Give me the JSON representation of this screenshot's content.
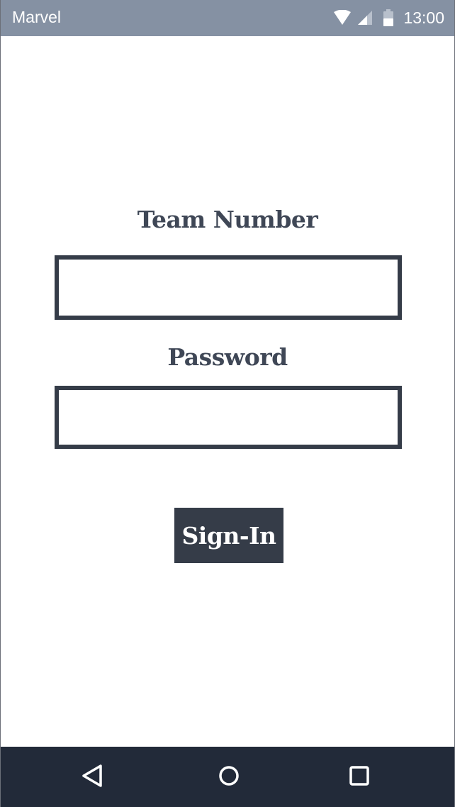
{
  "status_bar": {
    "app_name": "Marvel",
    "time": "13:00",
    "icons": [
      "wifi-icon",
      "cell-signal-icon",
      "battery-icon"
    ]
  },
  "form": {
    "team_number": {
      "label": "Team Number",
      "value": "",
      "placeholder": ""
    },
    "password": {
      "label": "Password",
      "value": "",
      "placeholder": ""
    },
    "submit_label": "Sign-In"
  },
  "nav_bar": {
    "icons": [
      "back-icon",
      "home-icon",
      "recents-icon"
    ]
  },
  "colors": {
    "status_bar": "#8591a3",
    "primary_dark": "#353c48",
    "label_text": "#3f4756",
    "nav_bar": "#222a39",
    "background": "#ffffff"
  }
}
